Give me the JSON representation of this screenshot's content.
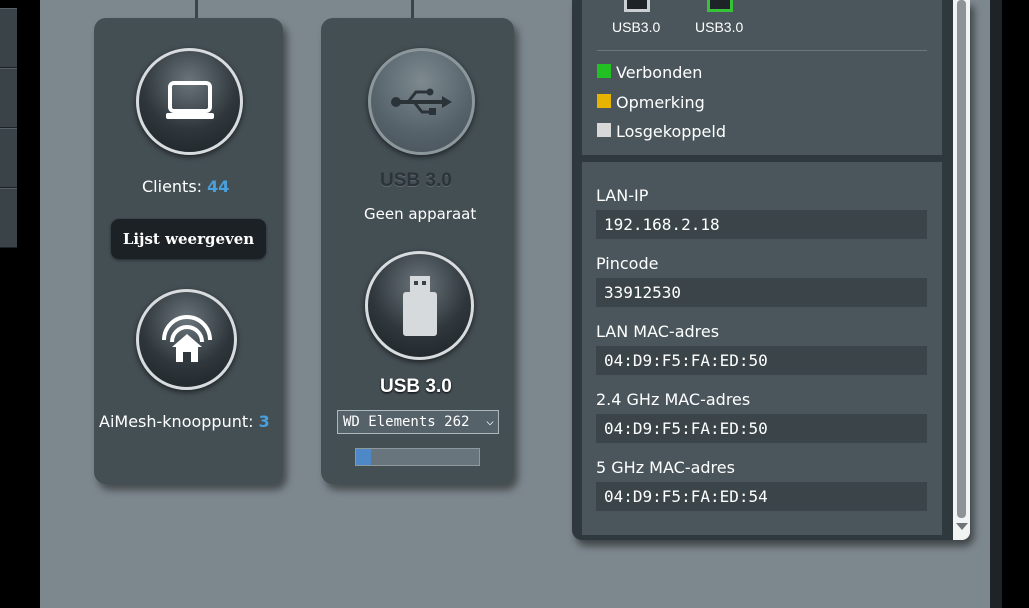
{
  "clients": {
    "label": "Clients:",
    "count": "44",
    "list_button": "Lijst weergeven"
  },
  "aimesh": {
    "label": "AiMesh-knooppunt:",
    "count": "3"
  },
  "usb_port_1": {
    "title": "USB 3.0",
    "status": "Geen apparaat"
  },
  "usb_port_2": {
    "title": "USB 3.0",
    "device_selected": "WD Elements 262",
    "usage_fraction": 0.12
  },
  "port_status": {
    "ports": [
      {
        "label": "USB3.0",
        "state": "disconnected"
      },
      {
        "label": "USB3.0",
        "state": "connected"
      }
    ],
    "legend": [
      {
        "label": "Verbonden",
        "color": "#22c022"
      },
      {
        "label": "Opmerking",
        "color": "#e6b400"
      },
      {
        "label": "Losgekoppeld",
        "color": "#d8d8d8"
      }
    ]
  },
  "device_info": {
    "lan_ip_label": "LAN-IP",
    "lan_ip": "192.168.2.18",
    "pincode_label": "Pincode",
    "pincode": "33912530",
    "lan_mac_label": "LAN MAC-adres",
    "lan_mac": "04:D9:F5:FA:ED:50",
    "mac_24_label": "2.4 GHz MAC-adres",
    "mac_24": "04:D9:F5:FA:ED:50",
    "mac_5_label": "5 GHz MAC-adres",
    "mac_5": "04:D9:F5:FA:ED:54"
  },
  "icons": {
    "clients": "monitor-icon",
    "aimesh": "mesh-home-icon",
    "usb_empty": "usb-symbol-icon",
    "usb_drive": "usb-drive-icon"
  },
  "colors": {
    "accent_number": "#4aa0dc",
    "card_bg": "#444f54",
    "page_bg": "#7d888e"
  }
}
